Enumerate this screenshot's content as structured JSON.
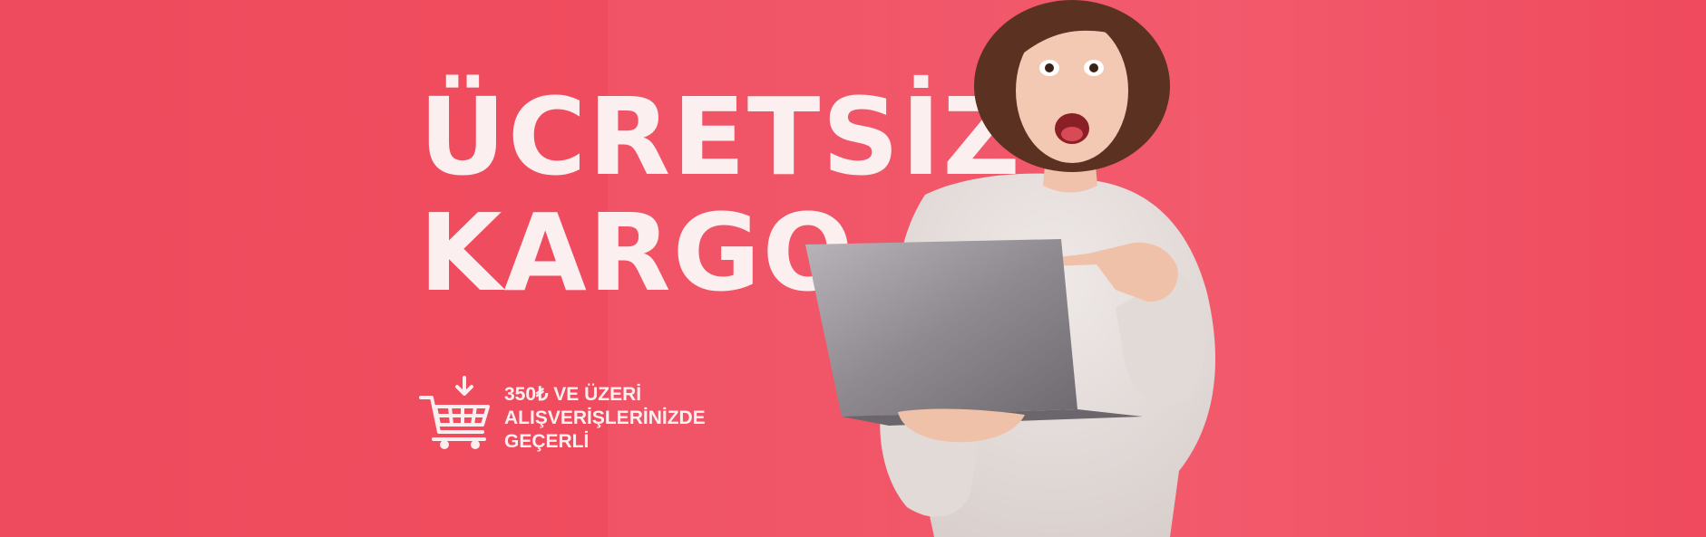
{
  "banner": {
    "headline_line1": "ÜCRETSİZ",
    "headline_line2": "KARGO",
    "promo_line1": "350₺ VE ÜZERİ",
    "promo_line2": "ALIŞVERİŞLERİNİZDE",
    "promo_line3": "GEÇERLİ",
    "icon": "shopping-cart-download-icon"
  },
  "colors": {
    "background": "#ef4b5e",
    "text": "#fbeff0",
    "sweater": "#e9e2df",
    "laptop": "#8f8a90"
  }
}
